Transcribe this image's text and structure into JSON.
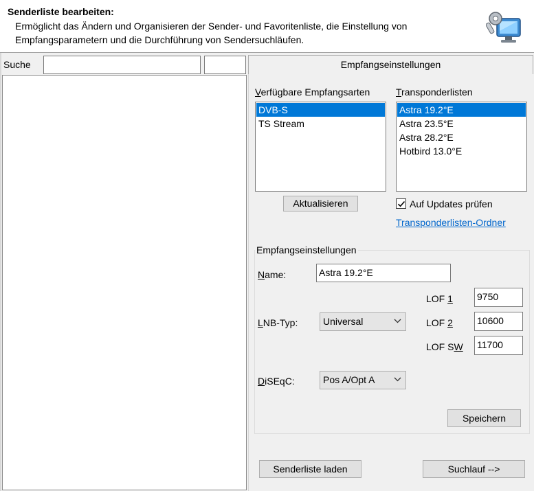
{
  "header": {
    "title": "Senderliste bearbeiten:",
    "description": "Ermöglicht das Ändern und Organisieren der Sender- und Favoritenliste, die Einstellung von Empfangsparametern und die Durchführung von Sendersuchläufen.",
    "icon": "computer-settings-icon"
  },
  "search": {
    "label": "Suche",
    "value": "",
    "value2": ""
  },
  "tab": {
    "label": "Empfangseinstellungen"
  },
  "reception_types": {
    "label": "Verfügbare Empfangsarten",
    "items": [
      "DVB-S",
      "TS Stream"
    ],
    "selected": "DVB-S"
  },
  "transponder_lists": {
    "label": "Transponderlisten",
    "items": [
      "Astra 19.2°E",
      "Astra 23.5°E",
      "Astra 28.2°E",
      "Hotbird 13.0°E"
    ],
    "selected": "Astra 19.2°E"
  },
  "buttons": {
    "refresh": "Aktualisieren",
    "save": "Speichern",
    "load_list": "Senderliste laden",
    "scan": "Suchlauf -->"
  },
  "check_updates": {
    "label": "Auf Updates prüfen",
    "checked": true
  },
  "transponder_folder_link": "Transponderlisten-Ordner",
  "settings": {
    "group_title": "Empfangseinstellungen",
    "name_label": "Name:",
    "name_value": "Astra 19.2°E",
    "lnb_label": "LNB-Typ:",
    "lnb_value": "Universal",
    "diseqc_label": "DiSEqC:",
    "diseqc_value": "Pos A/Opt A",
    "lof1_label": "LOF 1",
    "lof1_value": "9750",
    "lof2_label": "LOF 2",
    "lof2_value": "10600",
    "lofsw_label": "LOF SW",
    "lofsw_value": "11700"
  },
  "colors": {
    "selection": "#0078d7",
    "link": "#0066cc",
    "window_bg": "#f0f0f0"
  }
}
